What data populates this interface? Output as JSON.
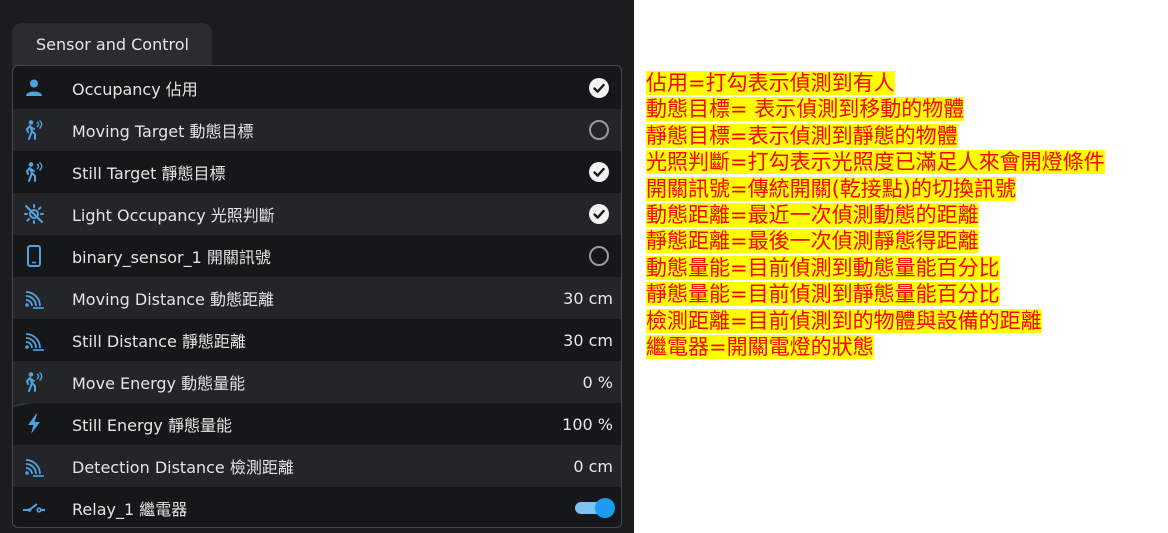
{
  "tab": {
    "label": "Sensor and Control"
  },
  "rows": [
    {
      "label": "Occupancy 佔用",
      "icon": "person-icon",
      "state": "checked"
    },
    {
      "label": "Moving Target 動態目標",
      "icon": "motion-sensor-icon",
      "state": "unchecked"
    },
    {
      "label": "Still Target 靜態目標",
      "icon": "motion-sensor-icon",
      "state": "checked"
    },
    {
      "label": "Light Occupancy 光照判斷",
      "icon": "brightness-off-icon",
      "state": "checked"
    },
    {
      "label": "binary_sensor_1 開關訊號",
      "icon": "cellphone-icon",
      "state": "unchecked"
    },
    {
      "label": "Moving Distance 動態距離",
      "icon": "signal-distance-icon",
      "value": "30 cm"
    },
    {
      "label": "Still Distance 靜態距離",
      "icon": "signal-distance-icon",
      "value": "30 cm"
    },
    {
      "label": "Move Energy 動態量能",
      "icon": "motion-sensor-icon",
      "value": "0 %"
    },
    {
      "label": "Still Energy 靜態量能",
      "icon": "lightning-bolt-icon",
      "value": "100 %"
    },
    {
      "label": "Detection Distance 檢測距離",
      "icon": "signal-distance-icon",
      "value": "0 cm"
    },
    {
      "label": "Relay_1 繼電器",
      "icon": "electric-switch-icon",
      "state": "on"
    }
  ],
  "notes": [
    "佔用=打勾表示偵測到有人",
    "動態目標= 表示偵測到移動的物體",
    "靜態目標=表示偵測到靜態的物體",
    "光照判斷=打勾表示光照度已滿足人來會開燈條件",
    "開關訊號=傳統開關(乾接點)的切換訊號",
    "動態距離=最近一次偵測動態的距離",
    "靜態距離=最後一次偵測靜態得距離",
    "動態量能=目前偵測到動態量能百分比",
    "靜態量能=目前偵測到靜態量能百分比",
    "檢測距離=目前偵測到的物體與設備的距離",
    "繼電器=開關電燈的狀態"
  ],
  "colors": {
    "icon": "#4fa3e0",
    "toggle_on": "#1a9df0",
    "note_text": "#ff0000",
    "note_highlight": "#ffff00"
  }
}
